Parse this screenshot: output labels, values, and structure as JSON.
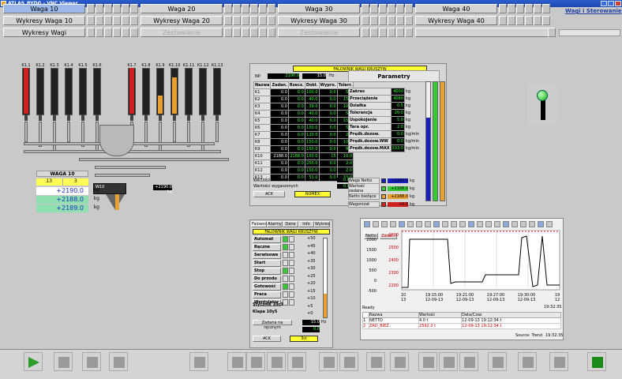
{
  "window": {
    "title": "ATLAS_BYDG - VNC Viewer"
  },
  "header": {
    "brand": "Wagi i Sterowanie"
  },
  "tabs_row1": [
    {
      "label": "Waga 10",
      "active": true
    },
    {
      "label": "Waga 20"
    },
    {
      "label": "Waga 30"
    },
    {
      "label": "Waga 40"
    }
  ],
  "tabs_row2": [
    {
      "label": "Wykresy Waga 10"
    },
    {
      "label": "Wykresy Waga 20"
    },
    {
      "label": "Wykresy Waga 30"
    },
    {
      "label": "Wykresy Waga 40"
    }
  ],
  "tabs_row3": [
    {
      "label": "Wykresy Wagi"
    },
    {
      "label": "Zestawienie",
      "disabled": true
    },
    {
      "label": "Zestawienie",
      "disabled": true
    }
  ],
  "silos": [
    "K1.1",
    "K1.2",
    "K1.3",
    "K1.4",
    "K1.5",
    "K1.6",
    "K1.7",
    "K1.8",
    "K1.9",
    "K1.10",
    "K1.11",
    "K1.12",
    "K1.13"
  ],
  "waga10": {
    "title": "WAGA 10",
    "left": "13",
    "right": "3",
    "v1": "+2190.0",
    "v2": "+2188.0",
    "v3": "+2189.0",
    "unit": "kg",
    "sub1": "+2190.0 kg",
    "sub2": "W10"
  },
  "fal1": {
    "title": "FALOWNIK WAGI KRUSZYW",
    "np": "NP.",
    "np_val": "2190.0",
    "kg_val": "15.0",
    "hz": "Hz",
    "params_title": "Parametry",
    "cols": [
      "Nazwa",
      "Zadan.",
      "Rzecz.",
      "Dokł.",
      "Wypro.",
      "Tolerr."
    ],
    "rows": [
      [
        "K1",
        "0.0",
        "0.0",
        "100.0",
        "0.0",
        "5.0"
      ],
      [
        "K2",
        "0.0",
        "0.0",
        "40.0",
        "0.0",
        "15.0"
      ],
      [
        "K3",
        "0.0",
        "0.0",
        "39.0",
        "0.0",
        "10.0"
      ],
      [
        "K4",
        "0.0",
        "0.0",
        "40.0",
        "0.0",
        "5.0"
      ],
      [
        "K5",
        "0.0",
        "0.0",
        "40.0",
        "0.0",
        "15.0"
      ],
      [
        "K6",
        "0.0",
        "0.0",
        "150.0",
        "0.0",
        "5.0"
      ],
      [
        "K7",
        "0.0",
        "0.0",
        "120.0",
        "0.0",
        "2.0"
      ],
      [
        "K8",
        "0.0",
        "0.0",
        "150.0",
        "0.0",
        "10.0"
      ],
      [
        "K9",
        "0.0",
        "0.0",
        "150.0",
        "0.0",
        "8.0"
      ],
      [
        "K10",
        "2188.0",
        "2188.0",
        "150.0",
        "15",
        "10.0"
      ],
      [
        "K11",
        "0.0",
        "0.0",
        "250.0",
        "0.0",
        "2.0"
      ],
      [
        "K12",
        "0.0",
        "0.0",
        "150.0",
        "0.0",
        "2.0"
      ],
      [
        "K13",
        "0.0",
        "0.0",
        "51.0",
        "0.0",
        "10.0"
      ]
    ],
    "params": [
      [
        "Zakres",
        "4000",
        "kg"
      ],
      [
        "Przeciążenie",
        "4080",
        "kg"
      ],
      [
        "Działka",
        "0.5",
        "kg"
      ],
      [
        "Tolerancja",
        "20.0",
        "kg"
      ],
      [
        "Uspokojenie",
        "5.0",
        "kg"
      ],
      [
        "Tara opr.",
        "2.0",
        "kg"
      ],
      [
        "Prędk.dozow.",
        "0.0",
        "kg/min"
      ],
      [
        "Prędk.dozow.WW",
        "0.0",
        "kg/min"
      ],
      [
        "Prędk.dozow.MAX",
        "333.0",
        "kg/min"
      ]
    ],
    "dozow": "Wartości dozowanie dokładnego",
    "dozow_val": "0.0",
    "wygr": "Wartości wygaszonych",
    "wygr_val": "0.0",
    "ack": "ACK",
    "numer": "NUMEX",
    "legend": [
      [
        "Waga Netto",
        "+2190.0",
        "kg"
      ],
      [
        "Wartość zadana",
        "+2188.0",
        "kg"
      ],
      [
        "Netto biežące",
        "+2188.0",
        "kg"
      ],
      [
        "Wagonizat",
        "+0.0",
        "kg"
      ]
    ]
  },
  "fal2": {
    "tabs": [
      "Falownik",
      "Alarmy",
      "Dane",
      "Info",
      "Wykres"
    ],
    "title": "FALOWNIK WAGI KRUSZYW",
    "items": [
      "Automat",
      "Ręczne",
      "Serwisowe",
      "Start",
      "Stop",
      "Do przodu",
      "Gotowość",
      "Praca",
      "Wentylator"
    ],
    "scale": [
      "+50",
      "+45",
      "+40",
      "+35",
      "+30",
      "+25",
      "+20",
      "+15",
      "+10",
      "+5",
      "+0"
    ],
    "stycznik": "Stycznik 10c3",
    "klapa": "Klapa 10y5",
    "zadana": "Zadana na ręcznym",
    "zad_val": "15.0",
    "hz": "Hz",
    "zero": "0.0",
    "ack": "ACK",
    "zero2": "3st"
  },
  "trend": {
    "tab1": "Netto",
    "tab2": "Zada...",
    "yleft": [
      "2000",
      "1500",
      "1000",
      "500",
      "0",
      "-500"
    ],
    "yright": [
      "2600",
      "2500",
      "2400",
      "2300",
      "2200"
    ],
    "xticks": [
      [
        "10",
        "13"
      ],
      [
        "19:15:00",
        "12-09-13"
      ],
      [
        "19:21:00",
        "12-09-13"
      ],
      [
        "19:27:00",
        "12-09-13"
      ],
      [
        "19:30:00",
        "12-09-13"
      ],
      [
        "19",
        "12"
      ]
    ],
    "status": "Ready",
    "status_time": "19:32:35",
    "cols": [
      "Nazwa",
      "Wartość",
      "Data/Czas"
    ],
    "rows": [
      [
        "1",
        "NETTO",
        "4.0 t",
        "12-09-13 19:12:34.t"
      ],
      [
        "2",
        "ZAD_BIEŻ",
        "2592.0 t",
        "12-09-13 19:12:34.t"
      ]
    ],
    "source": "Source: Trend",
    "source_time": "19:32:35"
  },
  "colors": {
    "bg": "#c9c9c9",
    "accent": "#ffff33",
    "ok": "#36c936"
  }
}
